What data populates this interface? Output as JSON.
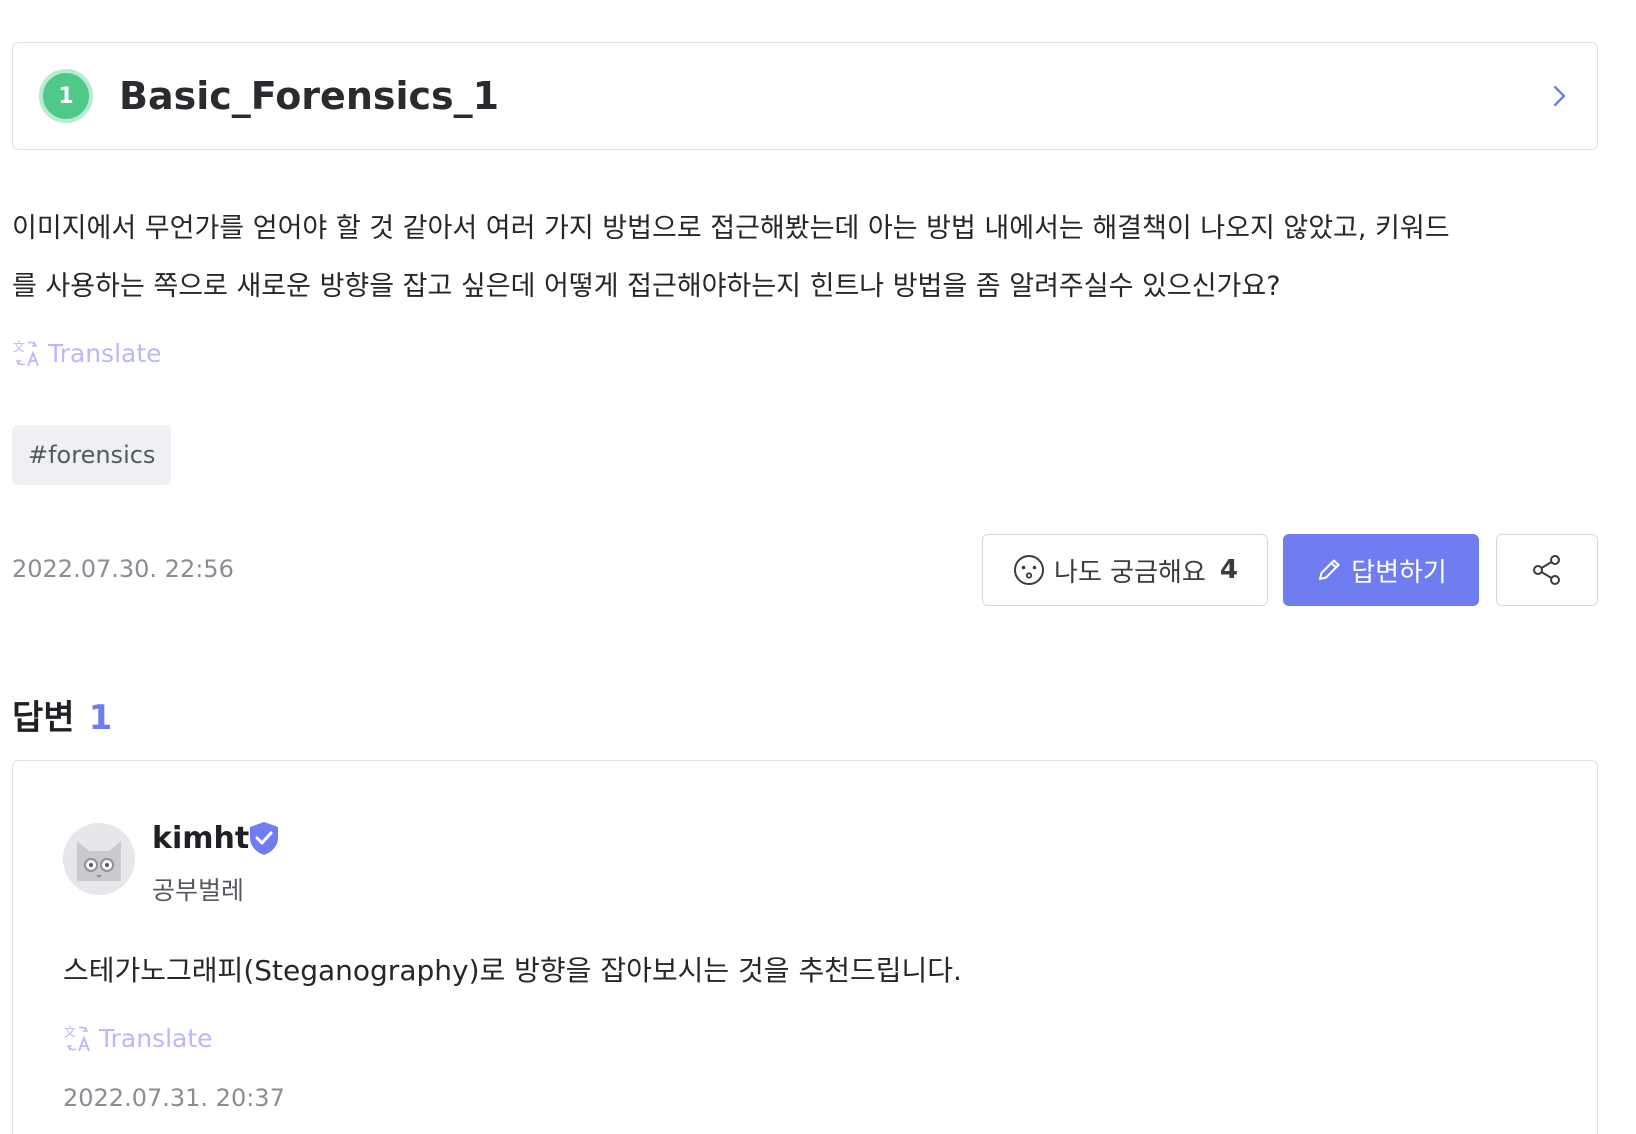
{
  "problem": {
    "level": "1",
    "title": "Basic_Forensics_1"
  },
  "question": {
    "line1": "이미지에서 무언가를 얻어야 할 것 같아서 여러 가지 방법으로 접근해봤는데 아는 방법 내에서는 해결책이 나오지 않았고, 키워드",
    "line2": "를 사용하는 쪽으로 새로운 방향을 잡고 싶은데 어떻게 접근해야하는지 힌트나 방법을 좀 알려주실수 있으신가요?",
    "translate_label": "Translate",
    "tag": "#forensics",
    "timestamp": "2022.07.30. 22:56"
  },
  "actions": {
    "curious_label": "나도 궁금해요",
    "curious_count": "4",
    "answer_label": "답변하기"
  },
  "answers": {
    "heading": "답변",
    "count": "1",
    "items": [
      {
        "author": "kimht",
        "role": "공부벌레",
        "body": "스테가노그래피(Steganography)로 방향을 잡아보시는 것을 추천드립니다.",
        "translate_label": "Translate",
        "timestamp": "2022.07.31. 20:37"
      }
    ]
  },
  "colors": {
    "accent": "#6f7df0",
    "level_badge": "#4fc987",
    "translate": "#b9b7ff"
  }
}
